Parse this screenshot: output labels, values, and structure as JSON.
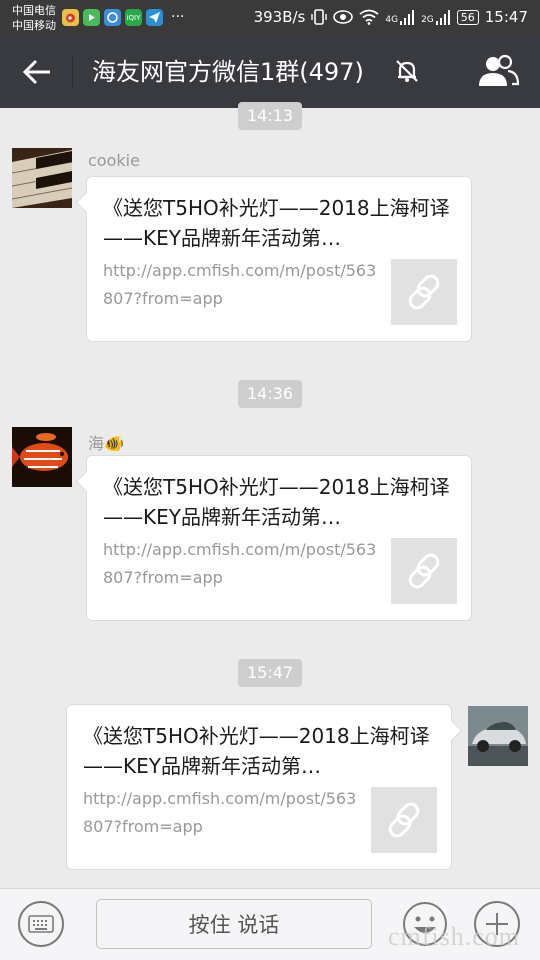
{
  "status_bar": {
    "carrier_1": "中国电信",
    "carrier_2": "中国移动",
    "app_icons": [
      "weibo-icon",
      "video-icon",
      "browser-icon",
      "iqiyi-icon",
      "paper-plane-icon"
    ],
    "more": "···",
    "net_speed": "393B/s",
    "signal_1_label": "4G",
    "signal_2_label": "2G",
    "battery": "56",
    "time": "15:47"
  },
  "nav": {
    "title": "海友网官方微信1群(497)",
    "muted": true
  },
  "messages": [
    {
      "timestamp": "14:13",
      "side": "left",
      "sender": "cookie",
      "avatar": "piano-keys",
      "title": "《送您T5HO补光灯——2018上海柯译——KEY品牌新年活动第…",
      "url": "http://app.cmfish.com/m/post/563807?from=app",
      "thumb_icon": "link-icon"
    },
    {
      "timestamp": "14:36",
      "side": "left",
      "sender": "海🐠",
      "avatar": "orange-fish",
      "title": "《送您T5HO补光灯——2018上海柯译——KEY品牌新年活动第…",
      "url": "http://app.cmfish.com/m/post/563807?from=app",
      "thumb_icon": "link-icon"
    },
    {
      "timestamp": "15:47",
      "side": "right",
      "avatar": "silver-car",
      "title": "《送您T5HO补光灯——2018上海柯译——KEY品牌新年活动第…",
      "url": "http://app.cmfish.com/m/post/563807?from=app",
      "thumb_icon": "link-icon"
    }
  ],
  "input_bar": {
    "hold_to_talk": "按住 说话"
  },
  "watermark": "cmfish.com",
  "colors": {
    "nav_bg": "#393a3f",
    "chat_bg": "#ebebeb",
    "time_pill": "#cecece"
  }
}
